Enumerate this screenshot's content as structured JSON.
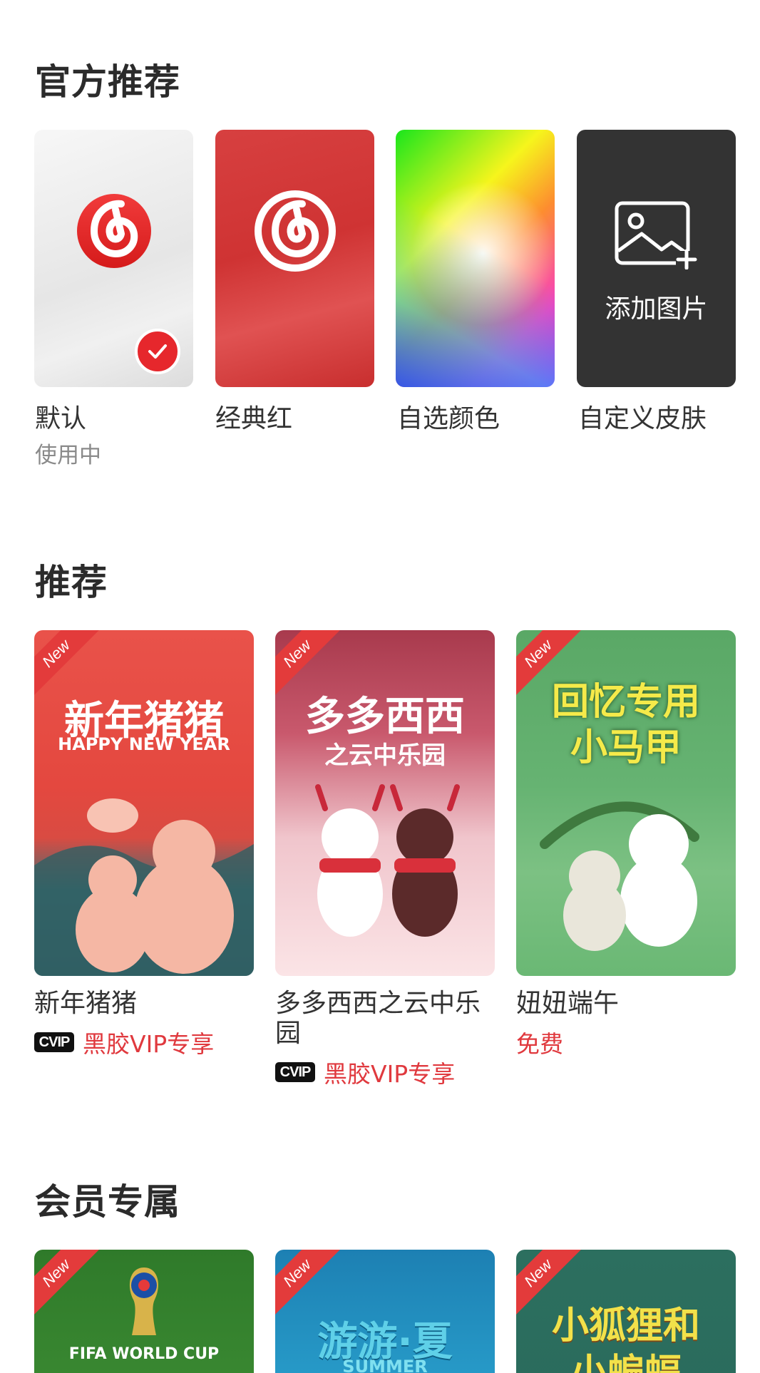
{
  "official": {
    "title": "官方推荐",
    "skins": [
      {
        "label": "默认",
        "status": "使用中"
      },
      {
        "label": "经典红"
      },
      {
        "label": "自选颜色"
      },
      {
        "label": "自定义皮肤",
        "add_label": "添加图片"
      }
    ]
  },
  "recommend": {
    "title": "推荐",
    "items": [
      {
        "name": "新年猪猪",
        "price": "黑胶VIP专享",
        "vip_badge": "CVIP",
        "art_title": "新年猪猪",
        "art_subtitle": "HAPPY NEW YEAR",
        "ribbon": "New"
      },
      {
        "name": "多多西西之云中乐园",
        "price": "黑胶VIP专享",
        "vip_badge": "CVIP",
        "art_title": "多多西西",
        "art_subtitle": "之云中乐园",
        "ribbon": "New"
      },
      {
        "name": "妞妞端午",
        "price": "免费",
        "art_title": "回忆专用",
        "art_subtitle": "小马甲",
        "ribbon": "New"
      }
    ]
  },
  "member": {
    "title": "会员专属",
    "items": [
      {
        "art_title": "FIFA WORLD CUP",
        "ribbon": "New"
      },
      {
        "art_title": "游游·夏",
        "art_subtitle": "SUMMER",
        "ribbon": "New"
      },
      {
        "art_title": "小狐狸和",
        "art_subtitle": "小蝙蝠",
        "ribbon": "New"
      }
    ]
  },
  "colors": {
    "accent": "#e0393e",
    "text": "#333333",
    "secondary": "#8a8a8a"
  }
}
